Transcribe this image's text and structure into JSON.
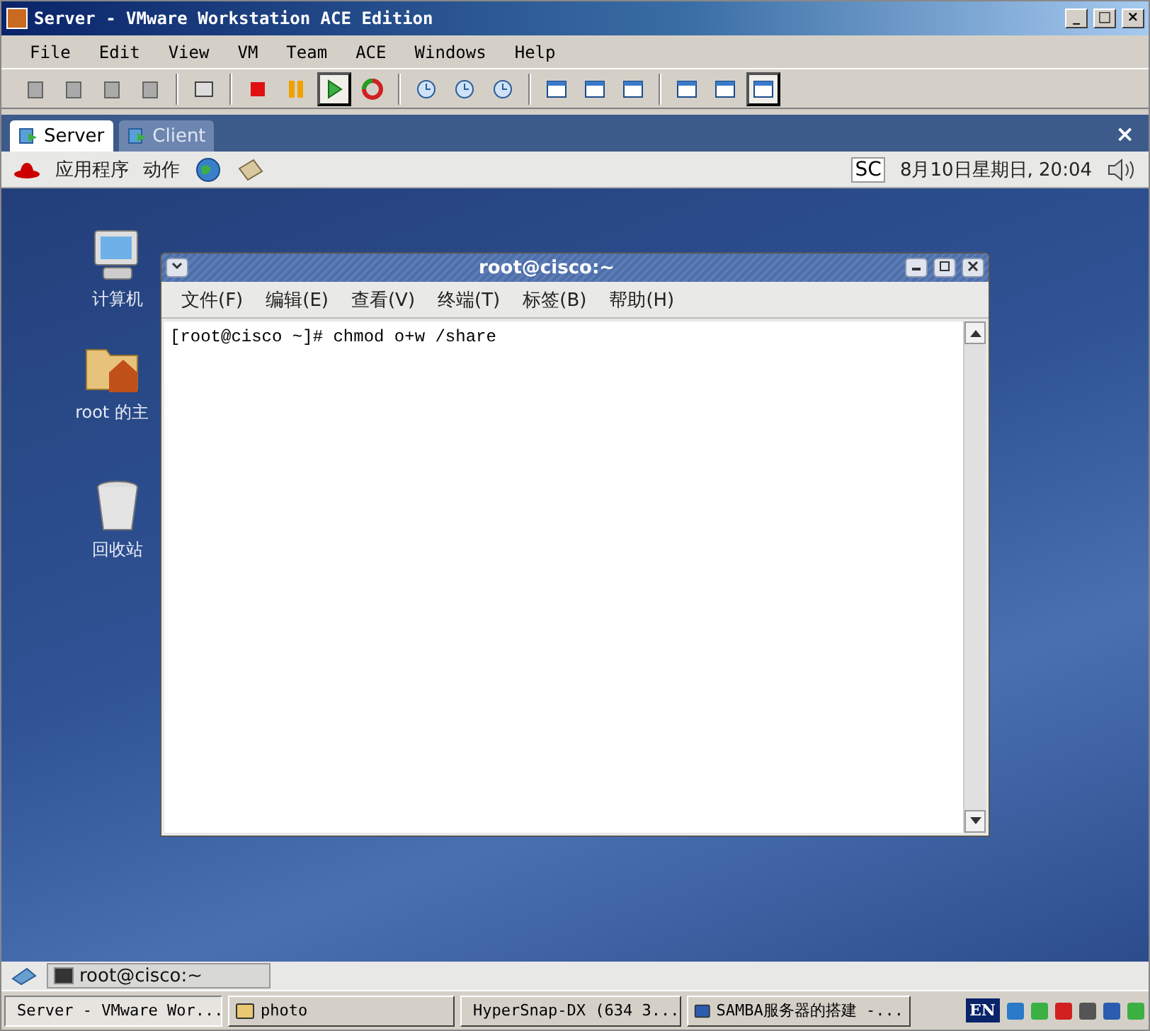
{
  "window": {
    "title": "Server - VMware Workstation ACE Edition",
    "controls": [
      "_",
      "□",
      "×"
    ]
  },
  "menu": [
    "File",
    "Edit",
    "View",
    "VM",
    "Team",
    "ACE",
    "Windows",
    "Help"
  ],
  "toolbar": [
    [
      {
        "kind": "snapshot",
        "pressed": false
      },
      {
        "kind": "snapshot",
        "pressed": false
      },
      {
        "kind": "snapshot",
        "pressed": false
      },
      {
        "kind": "snapshot",
        "pressed": false
      }
    ],
    [
      {
        "kind": "screen",
        "pressed": false
      }
    ],
    [
      {
        "kind": "stop",
        "pressed": false
      },
      {
        "kind": "pause",
        "pressed": false
      },
      {
        "kind": "play",
        "pressed": true
      },
      {
        "kind": "reset",
        "pressed": false
      }
    ],
    [
      {
        "kind": "clock",
        "pressed": false
      },
      {
        "kind": "clock",
        "pressed": false
      },
      {
        "kind": "clock",
        "pressed": false
      }
    ],
    [
      {
        "kind": "view",
        "pressed": false
      },
      {
        "kind": "view",
        "pressed": false
      },
      {
        "kind": "view",
        "pressed": false
      }
    ],
    [
      {
        "kind": "view",
        "pressed": false
      },
      {
        "kind": "view",
        "pressed": false
      },
      {
        "kind": "view",
        "pressed": true
      }
    ]
  ],
  "tabs": [
    {
      "label": "Server",
      "selected": true
    },
    {
      "label": "Client",
      "selected": false
    }
  ],
  "tab_close": "×",
  "guest_panel": {
    "menus": [
      "应用程序",
      "动作"
    ],
    "input": "SC",
    "clock": "8月10日星期日, 20:04"
  },
  "desktop_icons": [
    {
      "kind": "computer",
      "label": "计算机"
    },
    {
      "kind": "home",
      "label": "root 的主"
    },
    {
      "kind": "trash",
      "label": "回收站"
    }
  ],
  "terminal": {
    "title": "root@cisco:~",
    "menu": [
      "文件(F)",
      "编辑(E)",
      "查看(V)",
      "终端(T)",
      "标签(B)",
      "帮助(H)"
    ],
    "lines": [
      "[root@cisco ~]# chmod o+w /share"
    ]
  },
  "guest_taskbar": {
    "tasks": [
      "root@cisco:~"
    ]
  },
  "host_taskbar": {
    "tasks": [
      {
        "kind": "vmware",
        "label": "Server - VMware Wor..."
      },
      {
        "kind": "folder",
        "label": "photo"
      },
      {
        "kind": "camera",
        "label": "HyperSnap-DX (634 3..."
      },
      {
        "kind": "word",
        "label": "SAMBA服务器的搭建 -..."
      }
    ],
    "language": "EN"
  }
}
